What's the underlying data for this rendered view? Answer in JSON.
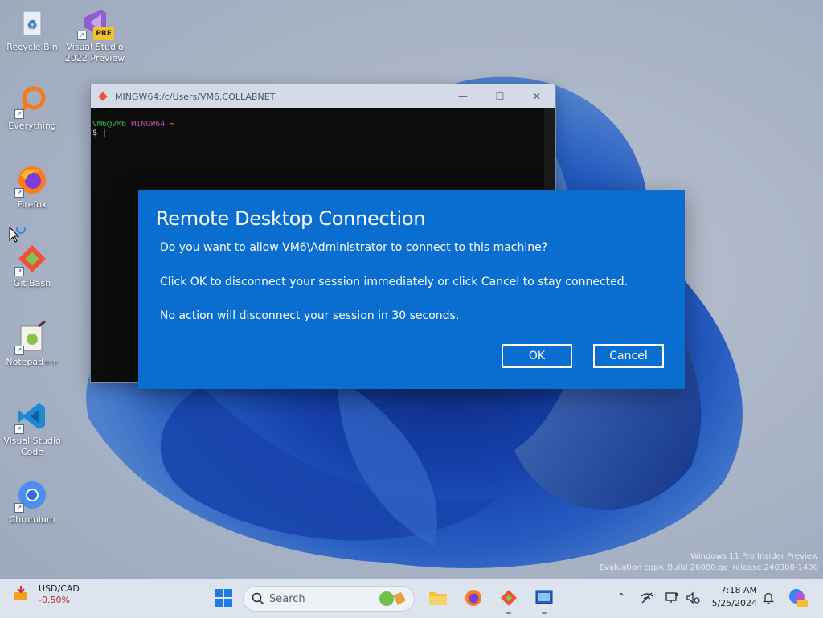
{
  "desktop": {
    "icons": [
      {
        "label": "Recycle Bin"
      },
      {
        "label": "Visual Studio 2022 Preview",
        "badge": "PRE"
      },
      {
        "label": "Everything"
      },
      {
        "label": "Firefox"
      },
      {
        "label": "Git Bash"
      },
      {
        "label": "Notepad++"
      },
      {
        "label": "Visual Studio Code"
      },
      {
        "label": "Chromium"
      }
    ]
  },
  "terminal": {
    "title": "MINGW64:/c/Users/VM6.COLLABNET",
    "prompt_user": "VM6@VM6",
    "prompt_env": "MINGW64",
    "prompt_path": "~",
    "prompt_symbol": "$",
    "controls": {
      "minimize": "—",
      "maximize": "☐",
      "close": "✕"
    }
  },
  "dialog": {
    "title": "Remote Desktop Connection",
    "line1": "Do you want to allow VM6\\Administrator to connect to this machine?",
    "line2": "Click OK to disconnect your session immediately or click Cancel to stay connected.",
    "line3": "No action will disconnect your session in 30 seconds.",
    "ok_label": "OK",
    "cancel_label": "Cancel"
  },
  "watermark": {
    "line1": "Windows 11 Pro Insider Preview",
    "line2": "Evaluation copy. Build 26080.ge_release.240308-1400"
  },
  "taskbar": {
    "weather": {
      "title": "USD/CAD",
      "change": "-0.50%"
    },
    "search_placeholder": "Search",
    "clock": {
      "time": "7:18 AM",
      "date": "5/25/2024"
    },
    "colors": {
      "accent": "#0a6ed1"
    }
  }
}
